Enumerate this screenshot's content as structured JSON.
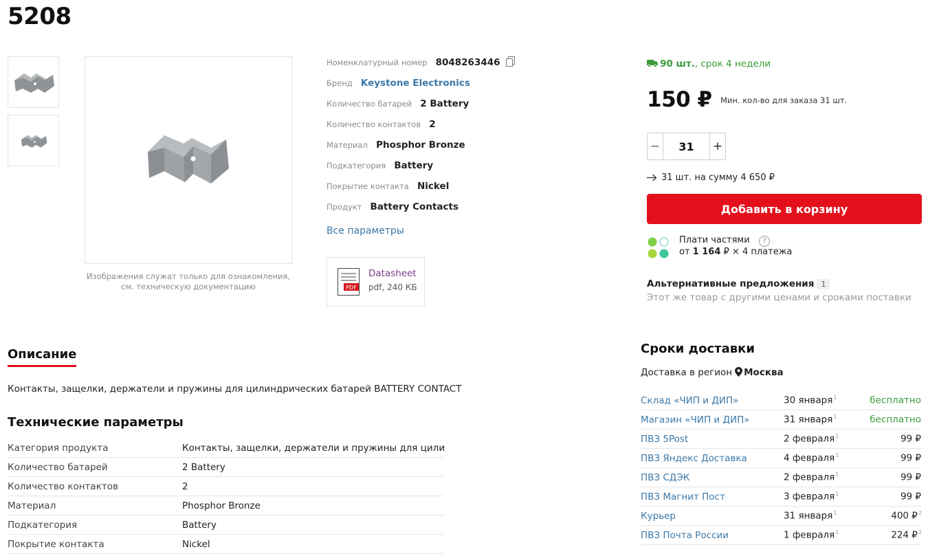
{
  "product": {
    "title": "5208",
    "image_note": "Изображения служат только для ознакомления, см. техническую документацию"
  },
  "params": [
    {
      "label": "Номенклатурный номер",
      "value": "8048263446"
    },
    {
      "label": "Бренд",
      "value": "Keystone Electronics"
    },
    {
      "label": "Количество батарей",
      "value": "2 Battery"
    },
    {
      "label": "Количество контактов",
      "value": "2"
    },
    {
      "label": "Материал",
      "value": "Phosphor Bronze"
    },
    {
      "label": "Подкатегория",
      "value": "Battery"
    },
    {
      "label": "Покрытие контакта",
      "value": "Nickel"
    },
    {
      "label": "Продукт",
      "value": "Battery Contacts"
    }
  ],
  "all_params_link": "Все параметры",
  "datasheet": {
    "title": "Datasheet",
    "size": "pdf, 240 КБ",
    "icon_label": "PDF"
  },
  "buy": {
    "stock_qty": "90 шт.",
    "stock_term": ", срок 4 недели",
    "price": "150 ₽",
    "min_qty": "Мин. кол-во для заказа 31 шт.",
    "quantity": "31",
    "minus": "−",
    "plus": "+",
    "sum_line": "31 шт. на сумму 4 650 ₽",
    "add_to_cart": "Добавить в корзину",
    "installments_label": "Плати частями",
    "installments_help": "?",
    "installments_prefix": "от ",
    "installments_amount": "1 164",
    "installments_suffix": " ₽ × 4 платежа",
    "alt_title": "Альтернативные предложения",
    "alt_count": "1",
    "alt_sub": "Этот же товар с другими ценами и сроками поставки"
  },
  "description": {
    "tab": "Описание",
    "text": "Контакты, защелки, держатели и пружины для цилиндрических батарей BATTERY CONTACT"
  },
  "tech": {
    "title": "Технические параметры",
    "rows": [
      {
        "k": "Категория продукта",
        "v": "Контакты, защелки, держатели и пружины для цилиндр"
      },
      {
        "k": "Количество батарей",
        "v": "2 Battery"
      },
      {
        "k": "Количество контактов",
        "v": "2"
      },
      {
        "k": "Материал",
        "v": "Phosphor Bronze"
      },
      {
        "k": "Подкатегория",
        "v": "Battery"
      },
      {
        "k": "Покрытие контакта",
        "v": "Nickel"
      }
    ]
  },
  "delivery": {
    "title": "Сроки доставки",
    "region_label": "Доставка в регион",
    "region": "Москва",
    "rows": [
      {
        "place": "Склад «ЧИП и ДИП»",
        "date": "30 января",
        "date_note": "1",
        "cost": "бесплатно",
        "cost_note": "",
        "free": true
      },
      {
        "place": "Магазин «ЧИП и ДИП»",
        "date": "31 января",
        "date_note": "1",
        "cost": "бесплатно",
        "cost_note": "",
        "free": true
      },
      {
        "place": "ПВЗ 5Post",
        "date": "2 февраля",
        "date_note": "1",
        "cost": "99 ₽",
        "cost_note": "",
        "free": false
      },
      {
        "place": "ПВЗ Яндекс Доставка",
        "date": "4 февраля",
        "date_note": "1",
        "cost": "99 ₽",
        "cost_note": "",
        "free": false
      },
      {
        "place": "ПВЗ СДЭК",
        "date": "2 февраля",
        "date_note": "1",
        "cost": "99 ₽",
        "cost_note": "",
        "free": false
      },
      {
        "place": "ПВЗ Магнит Пост",
        "date": "3 февраля",
        "date_note": "1",
        "cost": "99 ₽",
        "cost_note": "",
        "free": false
      },
      {
        "place": "Курьер",
        "date": "31 января",
        "date_note": "1",
        "cost": "400 ₽",
        "cost_note": "2",
        "free": false
      },
      {
        "place": "ПВЗ Почта России",
        "date": "1 февраля",
        "date_note": "1",
        "cost": "224 ₽",
        "cost_note": "2",
        "free": false
      }
    ]
  },
  "colors": {
    "accent": "#e3101b",
    "link": "#3b78a8",
    "green": "#3a9a3a",
    "datasheet": "#7a3a8a"
  },
  "icons": [
    "copy-icon",
    "truck-icon",
    "arrow-right-icon",
    "pdf-file-icon",
    "map-pin-icon",
    "help-icon"
  ]
}
